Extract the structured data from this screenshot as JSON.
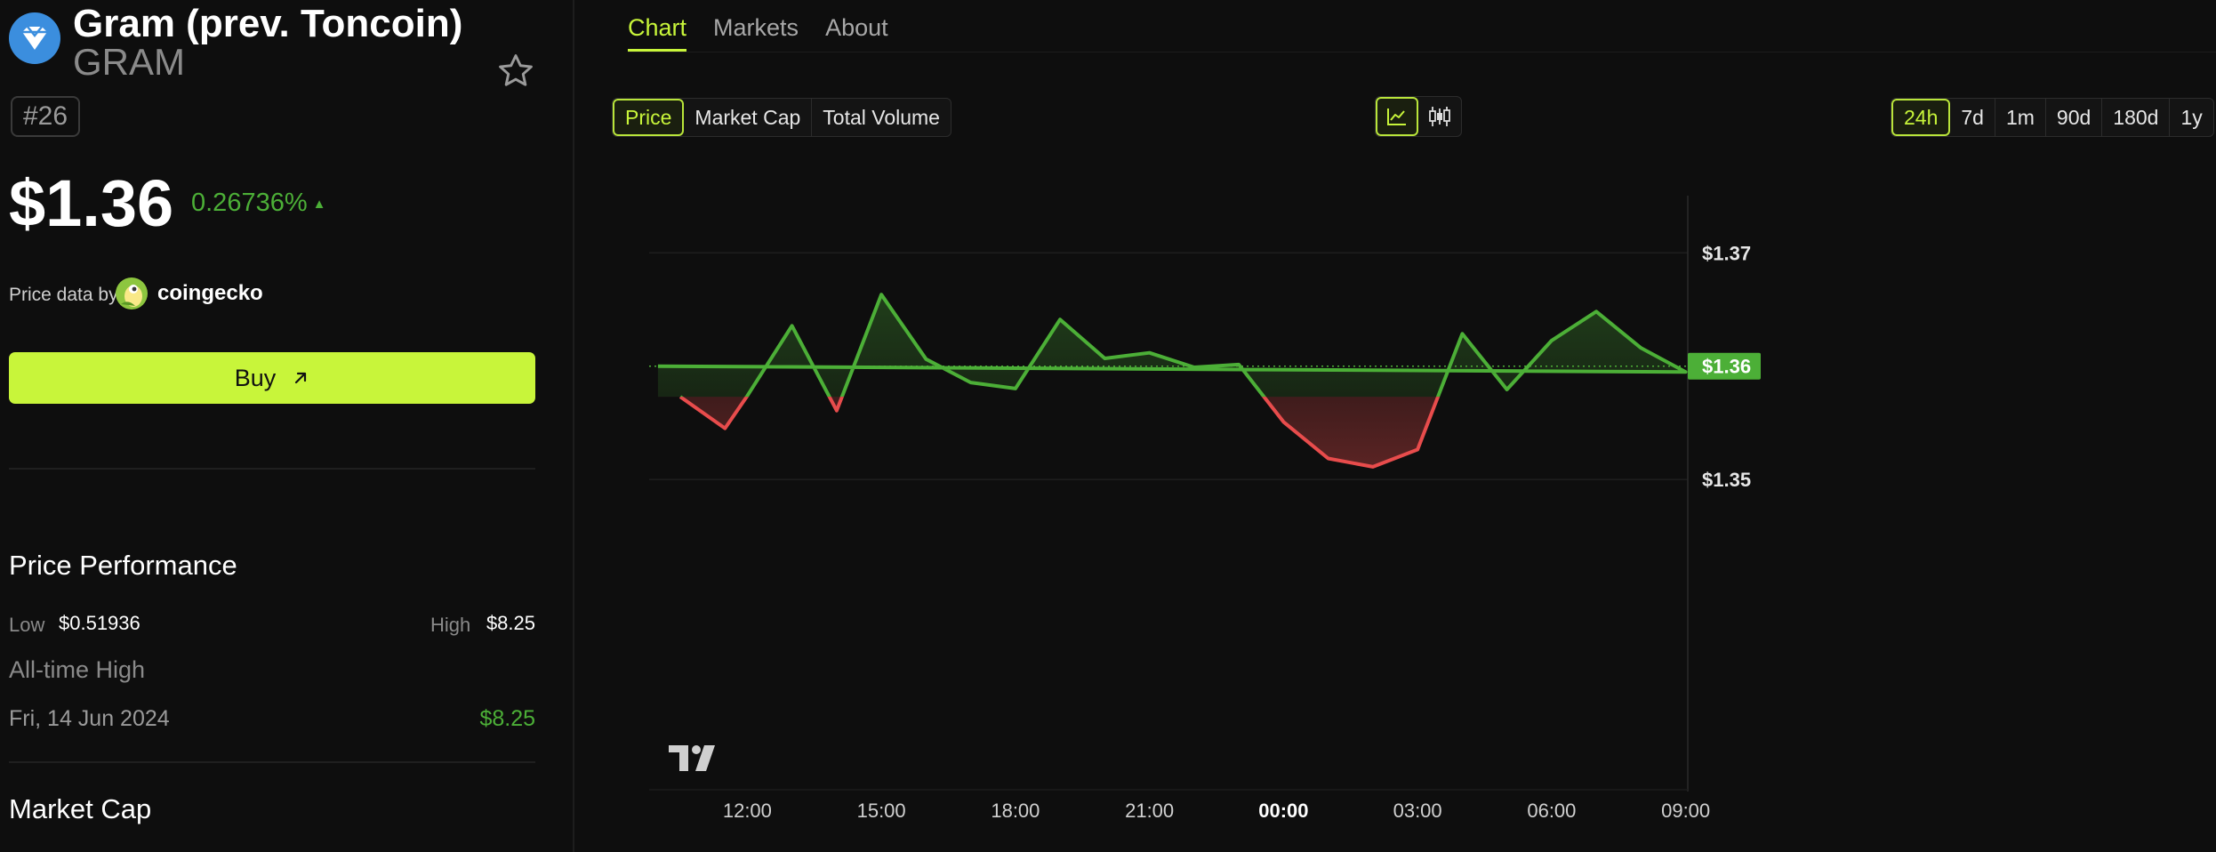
{
  "coin": {
    "name": "Gram (prev. Toncoin)",
    "ticker": "GRAM",
    "rank": "#26",
    "price": "$1.36",
    "change": "0.26736%",
    "change_arrow": "▲",
    "price_data_label": "Price data by",
    "price_data_source": "coingecko",
    "buy_label": "Buy",
    "favorite_icon": "star-outline-icon"
  },
  "performance": {
    "title": "Price Performance",
    "low_label": "Low",
    "low_value": "$0.51936",
    "high_label": "High",
    "high_value": "$8.25",
    "ath_label": "All-time High",
    "ath_date": "Fri, 14 Jun 2024",
    "ath_value": "$8.25"
  },
  "market_cap": {
    "title": "Market Cap"
  },
  "tabs": [
    {
      "label": "Chart",
      "active": true
    },
    {
      "label": "Markets",
      "active": false
    },
    {
      "label": "About",
      "active": false
    }
  ],
  "metric_toggle": [
    {
      "label": "Price",
      "active": true
    },
    {
      "label": "Market Cap",
      "active": false
    },
    {
      "label": "Total Volume",
      "active": false
    }
  ],
  "chart_type_toggle": [
    {
      "icon": "line-chart-icon",
      "active": true
    },
    {
      "icon": "candlestick-icon",
      "active": false
    }
  ],
  "range_toggle": [
    {
      "label": "24h",
      "active": true
    },
    {
      "label": "7d",
      "active": false
    },
    {
      "label": "1m",
      "active": false
    },
    {
      "label": "90d",
      "active": false
    },
    {
      "label": "180d",
      "active": false
    },
    {
      "label": "1y",
      "active": false
    }
  ],
  "colors": {
    "accent": "#c8f53a",
    "up": "#4caf37",
    "down": "#e84c4c",
    "background": "#0e0e0e"
  },
  "chart_data": {
    "type": "line",
    "x": [
      "10:30",
      "11:30",
      "12:00",
      "13:00",
      "14:00",
      "15:00",
      "16:00",
      "17:00",
      "18:00",
      "19:00",
      "20:00",
      "21:00",
      "22:00",
      "23:00",
      "00:00",
      "01:00",
      "02:00",
      "03:00",
      "04:00",
      "05:00",
      "06:00",
      "07:00",
      "08:00",
      "09:00",
      "10:00"
    ],
    "values": [
      1.35365,
      1.35226,
      1.35369,
      1.35678,
      1.35304,
      1.35816,
      1.35531,
      1.35428,
      1.35401,
      1.35706,
      1.35534,
      1.35559,
      1.35495,
      1.35507,
      1.35254,
      1.35093,
      1.35056,
      1.35132,
      1.35643,
      1.35397,
      1.35613,
      1.35741,
      1.3558,
      1.35474,
      1.355
    ],
    "baseline": 1.35365,
    "current_price_label": "$1.36",
    "current_value": 1.355,
    "x_tick_labels": [
      "12:00",
      "15:00",
      "18:00",
      "21:00",
      "00:00",
      "03:00",
      "06:00",
      "09:00"
    ],
    "y_tick_labels": [
      "$1.37",
      "$1.35"
    ],
    "y_ticks": [
      1.36,
      1.35
    ],
    "y_range": [
      1.3493,
      1.36107
    ],
    "grid": true,
    "watermark": "TV"
  }
}
